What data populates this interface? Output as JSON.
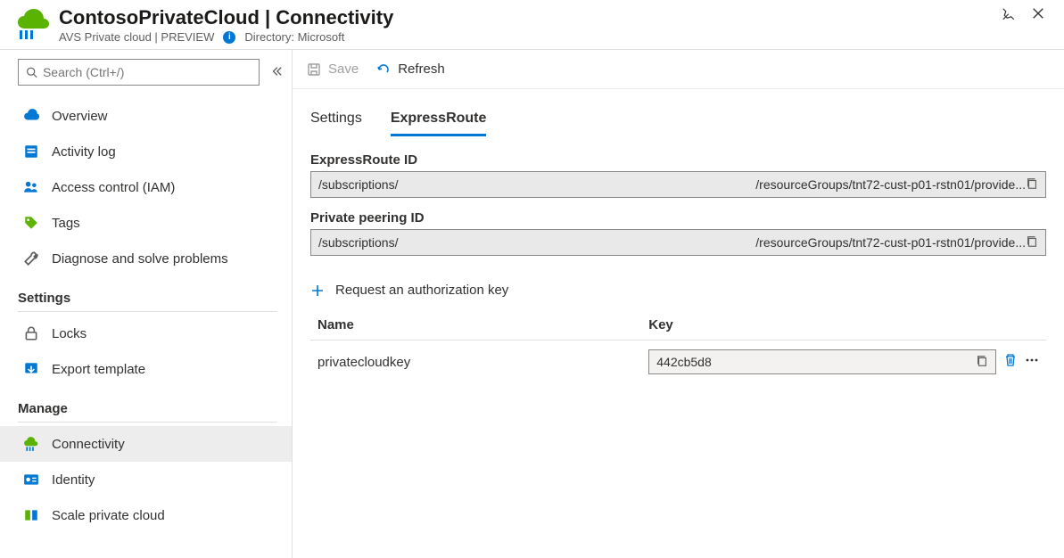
{
  "header": {
    "title": "ContosoPrivateCloud | Connectivity",
    "subtitle": "AVS Private cloud | PREVIEW",
    "directory_label": "Directory: Microsoft"
  },
  "sidebar": {
    "search_placeholder": "Search (Ctrl+/)",
    "items_top": [
      {
        "label": "Overview",
        "icon": "cloud-icon"
      },
      {
        "label": "Activity log",
        "icon": "activity-icon"
      },
      {
        "label": "Access control (IAM)",
        "icon": "people-icon"
      },
      {
        "label": "Tags",
        "icon": "tag-icon"
      },
      {
        "label": "Diagnose and solve problems",
        "icon": "wrench-icon"
      }
    ],
    "group_settings": {
      "title": "Settings",
      "items": [
        {
          "label": "Locks",
          "icon": "lock-icon"
        },
        {
          "label": "Export template",
          "icon": "export-icon"
        }
      ]
    },
    "group_manage": {
      "title": "Manage",
      "items": [
        {
          "label": "Connectivity",
          "icon": "connectivity-icon",
          "selected": true
        },
        {
          "label": "Identity",
          "icon": "identity-icon"
        },
        {
          "label": "Scale private cloud",
          "icon": "scale-icon"
        }
      ]
    }
  },
  "toolbar": {
    "save_label": "Save",
    "refresh_label": "Refresh"
  },
  "tabs": {
    "settings": "Settings",
    "expressroute": "ExpressRoute"
  },
  "fields": {
    "expressroute_id_label": "ExpressRoute ID",
    "expressroute_id_left": "/subscriptions/",
    "expressroute_id_right": "/resourceGroups/tnt72-cust-p01-rstn01/provide...",
    "private_peering_label": "Private peering ID",
    "private_peering_left": "/subscriptions/",
    "private_peering_right": "/resourceGroups/tnt72-cust-p01-rstn01/provide..."
  },
  "request_key_label": "Request an authorization key",
  "table": {
    "col_name": "Name",
    "col_key": "Key",
    "rows": [
      {
        "name": "privatecloudkey",
        "key": "442cb5d8"
      }
    ]
  }
}
